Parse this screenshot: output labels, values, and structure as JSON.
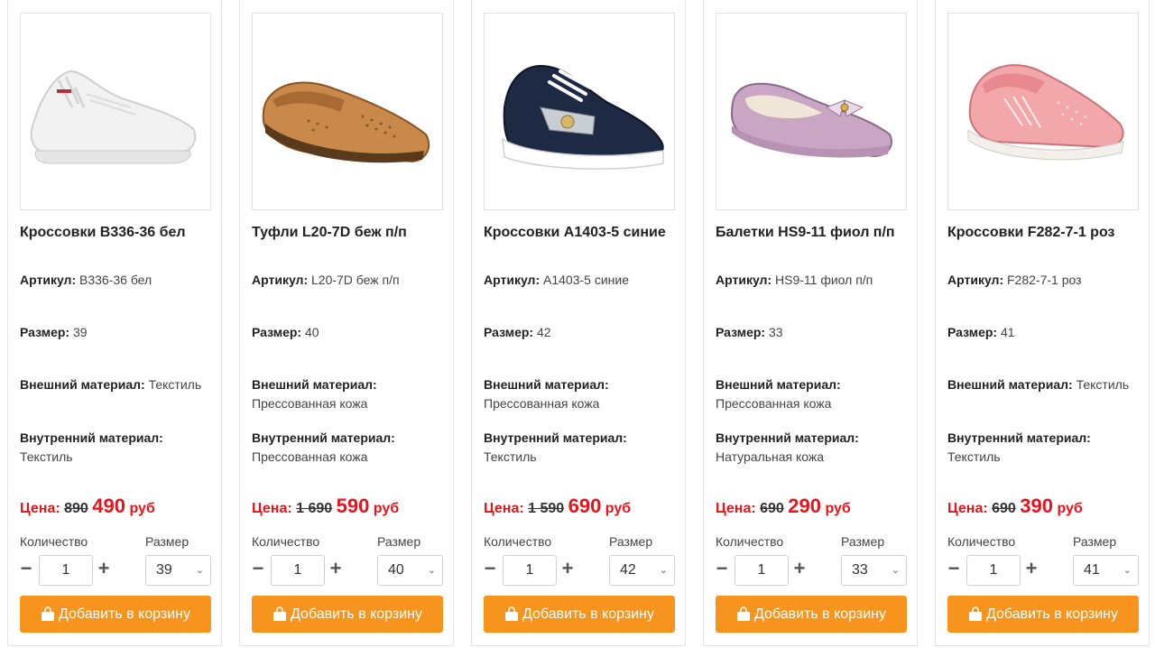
{
  "labels": {
    "article": "Артикул:",
    "size": "Размер:",
    "outer": "Внешний материал:",
    "inner": "Внутренний материал:",
    "price": "Цена:",
    "currency": "руб",
    "qty": "Количество",
    "size_select": "Размер",
    "minus": "−",
    "plus": "+",
    "add_to_cart": "Добавить в корзину"
  },
  "colors": {
    "accent": "#f7941d",
    "price_red": "#e8141b"
  },
  "products": [
    {
      "title": "Кроссовки B336-36 бел",
      "article": "B336-36 бел",
      "size": "39",
      "outer": "Текстиль",
      "inner": "Текстиль",
      "old_price": "890",
      "new_price": "490",
      "qty": "1",
      "selected_size": "39",
      "image": "white-knit-sneaker"
    },
    {
      "title": "Туфли L20-7D беж п/п",
      "article": "L20-7D беж п/п",
      "size": "40",
      "outer": "Прессованная кожа",
      "inner": "Прессованная кожа",
      "old_price": "1 690",
      "new_price": "590",
      "qty": "1",
      "selected_size": "40",
      "image": "beige-perforated-loafer"
    },
    {
      "title": "Кроссовки A1403-5 синие",
      "article": "A1403-5 синие",
      "size": "42",
      "outer": "Прессованная кожа",
      "inner": "Текстиль",
      "old_price": "1 590",
      "new_price": "690",
      "qty": "1",
      "selected_size": "42",
      "image": "navy-sneaker"
    },
    {
      "title": "Балетки HS9-11 фиол п/п",
      "article": "HS9-11 фиол п/п",
      "size": "33",
      "outer": "Прессованная кожа",
      "inner": "Натуральная кожа",
      "old_price": "690",
      "new_price": "290",
      "qty": "1",
      "selected_size": "33",
      "image": "lilac-ballet-flat"
    },
    {
      "title": "Кроссовки F282-7-1 роз",
      "article": "F282-7-1 роз",
      "size": "41",
      "outer": "Текстиль",
      "inner": "Текстиль",
      "old_price": "690",
      "new_price": "390",
      "qty": "1",
      "selected_size": "41",
      "image": "pink-slip-on-sneaker"
    }
  ]
}
